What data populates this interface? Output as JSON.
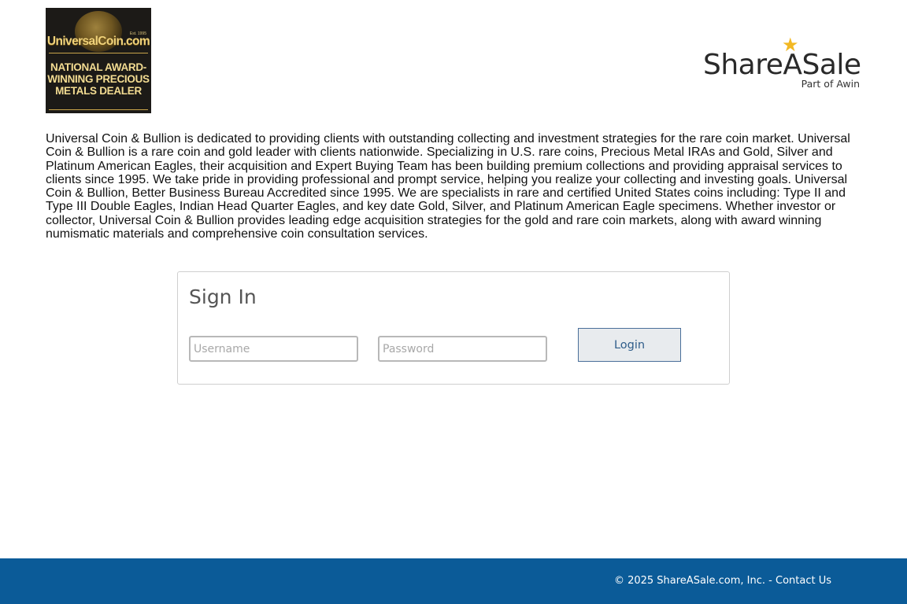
{
  "merchant": {
    "logo_brand": "UniversalCoin.com",
    "logo_est": "Est. 1995",
    "logo_tagline": "National Award-Winning Precious Metals Dealer",
    "description": "Universal Coin & Bullion is dedicated to providing clients with outstanding collecting and investment strategies for the rare coin market. Universal Coin & Bullion is a rare coin and gold leader with clients nationwide. Specializing in U.S. rare coins, Precious Metal IRAs and Gold, Silver and Platinum American Eagles, their acquisition and Expert Buying Team has been building premium collections and providing appraisal services to clients since 1995. We take pride in providing professional and prompt service, helping you realize your collecting and investing goals. Universal Coin & Bullion, Better Business Bureau Accredited since 1995. We are specialists in rare and certified United States coins including: Type II and Type III Double Eagles, Indian Head Quarter Eagles, and key date Gold, Silver, and Platinum American Eagle specimens. Whether investor or collector, Universal Coin & Bullion provides leading edge acquisition strategies for the gold and rare coin markets, along with award winning numismatic materials and comprehensive coin consultation services."
  },
  "network_logo": {
    "name": "ShareASale",
    "subtitle": "Part of Awin",
    "icon": "star-icon",
    "star_color": "#f2b823"
  },
  "signin": {
    "title": "Sign In",
    "username_placeholder": "Username",
    "username_value": "",
    "password_placeholder": "Password",
    "password_value": "",
    "login_label": "Login"
  },
  "footer": {
    "copyright": "© 2025 ShareASale.com, Inc. - ",
    "contact_label": "Contact Us",
    "background_color": "#0b5b98"
  }
}
